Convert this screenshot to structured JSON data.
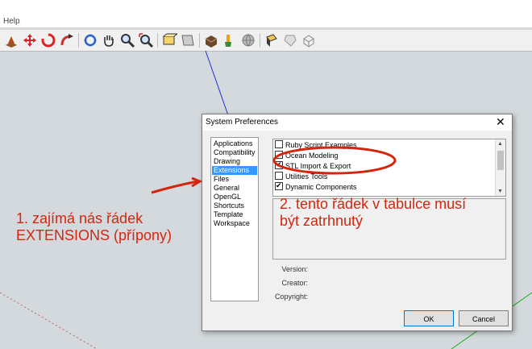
{
  "menu": {
    "help": "Help"
  },
  "toolbar": {
    "icons": [
      "rock-icon",
      "move-icon",
      "rotate-icon",
      "follow-me-icon",
      "orbit-icon",
      "pan-hand-icon",
      "zoom-icon",
      "zoom-extents-icon",
      "section-plane-icon",
      "display-section-icon",
      "component-icon",
      "paint-icon",
      "geo-location-icon",
      "photo-textures-icon",
      "arrow-sandbox-icon",
      "smoove-icon",
      "stamp-icon"
    ]
  },
  "dialog": {
    "title": "System Preferences",
    "close_glyph": "✕",
    "categories": [
      "Applications",
      "Compatibility",
      "Drawing",
      "Extensions",
      "Files",
      "General",
      "OpenGL",
      "Shortcuts",
      "Template",
      "Workspace"
    ],
    "selected_category": "Extensions",
    "extensions": [
      {
        "label": "Ruby Script Examples",
        "checked": false
      },
      {
        "label": "Ocean Modeling",
        "checked": false
      },
      {
        "label": "STL Import & Export",
        "checked": true
      },
      {
        "label": "Utilities Tools",
        "checked": false
      },
      {
        "label": "Dynamic Components",
        "checked": true
      }
    ],
    "version_label": "Version:",
    "creator_label": "Creator:",
    "copyright_label": "Copyright:",
    "ok_label": "OK",
    "cancel_label": "Cancel"
  },
  "annotations": {
    "note1_line1": "1. zajímá nás řádek",
    "note1_line2": "EXTENSIONS (přípony)",
    "note2_line1": "2. tento řádek v tabulce musí",
    "note2_line2": "být zatrhnutý",
    "color": "#d4260f"
  },
  "colors": {
    "selection": "#3399ff",
    "axis_blue": "#2233cc",
    "axis_green": "#22aa22"
  }
}
